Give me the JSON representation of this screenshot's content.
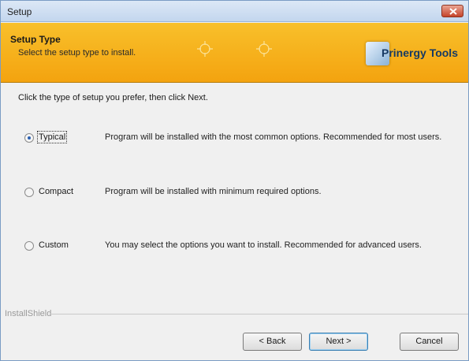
{
  "window": {
    "title": "Setup"
  },
  "banner": {
    "title": "Setup Type",
    "subtitle": "Select the setup type to install.",
    "logo_text": "Prinergy Tools"
  },
  "content": {
    "instruction": "Click the type of setup you prefer, then click Next.",
    "options": [
      {
        "label": "Typical",
        "description": "Program will be installed with the most common options.  Recommended for most users.",
        "selected": true
      },
      {
        "label": "Compact",
        "description": "Program will be installed with minimum required options.",
        "selected": false
      },
      {
        "label": "Custom",
        "description": "You may select the options you want to install. Recommended for advanced users.",
        "selected": false
      }
    ]
  },
  "footer": {
    "brand": "InstallShield",
    "back_label": "< Back",
    "next_label": "Next >",
    "cancel_label": "Cancel"
  },
  "colors": {
    "banner": "#f4a30f",
    "title_bar": "#c3d6ee",
    "close_button": "#c5432a"
  },
  "icons": {
    "close": "close-icon",
    "logo": "prinergy-logo-icon",
    "banner_decoration": "crosshair-icon"
  }
}
